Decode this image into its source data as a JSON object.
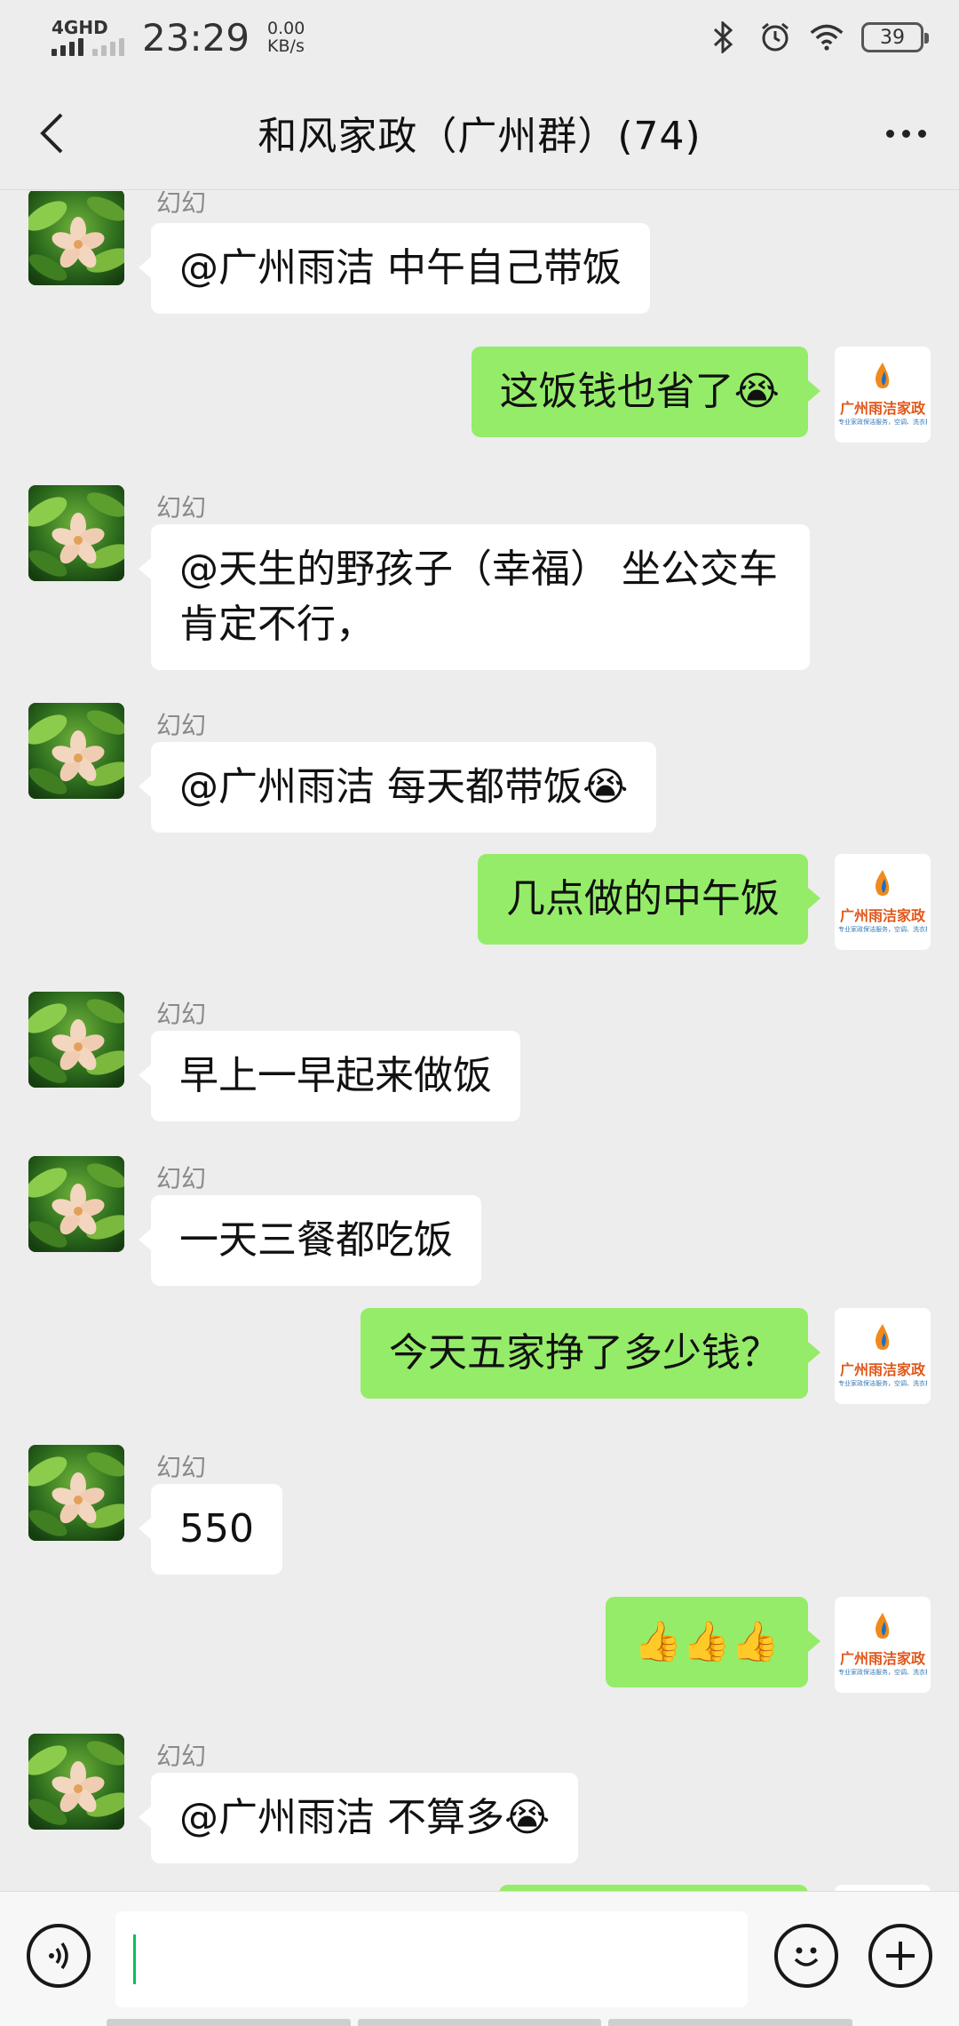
{
  "status_bar": {
    "network": "4GHD",
    "time": "23:29",
    "speed_value": "0.00",
    "speed_unit": "KB/s",
    "battery": "39"
  },
  "header": {
    "title": "和风家政（广州群）(74)"
  },
  "avatars": {
    "self_logo_text": "广州雨洁家政",
    "self_logo_sub": "专业家政保洁服务，空调、洗衣机"
  },
  "messages": [
    {
      "side": "in",
      "sender": "幻幻",
      "text": "@广州雨洁  中午自己带饭"
    },
    {
      "side": "out",
      "text": "这饭钱也省了😭"
    },
    {
      "side": "in",
      "sender": "幻幻",
      "text": "@天生的野孩子（幸福）  坐公交车肯定不行，"
    },
    {
      "side": "in",
      "sender": "幻幻",
      "text": "@广州雨洁  每天都带饭😭"
    },
    {
      "side": "out",
      "text": "几点做的中午饭"
    },
    {
      "side": "in",
      "sender": "幻幻",
      "text": "早上一早起来做饭"
    },
    {
      "side": "in",
      "sender": "幻幻",
      "text": "一天三餐都吃饭"
    },
    {
      "side": "out",
      "text": "今天五家挣了多少钱？"
    },
    {
      "side": "in",
      "sender": "幻幻",
      "text": "550"
    },
    {
      "side": "out",
      "text": "👍👍👍"
    },
    {
      "side": "in",
      "sender": "幻幻",
      "text": "@广州雨洁  不算多😭"
    }
  ],
  "input": {
    "value": ""
  }
}
